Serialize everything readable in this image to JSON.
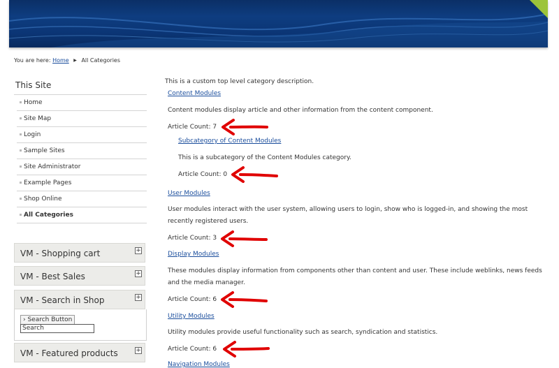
{
  "breadcrumb": {
    "prefix": "You are here:",
    "home": "Home",
    "current": "All Categories"
  },
  "sidebar": {
    "title": "This Site",
    "items": [
      {
        "label": "Home"
      },
      {
        "label": "Site Map"
      },
      {
        "label": "Login"
      },
      {
        "label": "Sample Sites"
      },
      {
        "label": "Site Administrator"
      },
      {
        "label": "Example Pages"
      },
      {
        "label": "Shop Online"
      },
      {
        "label": "All Categories"
      }
    ],
    "modules": [
      {
        "title": "VM - Shopping cart"
      },
      {
        "title": "VM - Best Sales"
      },
      {
        "title": "VM - Search in Shop"
      },
      {
        "title": "VM - Featured products"
      }
    ],
    "search": {
      "button_label": "› Search Button",
      "input_value": "Search"
    }
  },
  "content": {
    "intro": "This is a custom top level category description.",
    "categories": [
      {
        "name": "Content Modules",
        "description": "Content modules display article and other information from the content component.",
        "count": "Article Count: 7",
        "sub": {
          "name": "Subcategory of Content Modules",
          "description": "This is a subcategory of the Content Modules category.",
          "count": "Article Count: 0"
        }
      },
      {
        "name": "User Modules",
        "description": "User modules interact with the user system, allowing users to login, show who is logged-in, and showing the most recently registered users.",
        "count": "Article Count: 3"
      },
      {
        "name": "Display Modules",
        "description": "These modules display information from components other than content and user. These include weblinks, news feeds and the media manager.",
        "count": "Article Count: 6"
      },
      {
        "name": "Utility Modules",
        "description": "Utility modules provide useful functionality such as search, syndication and statistics.",
        "count": "Article Count: 6"
      },
      {
        "name": "Navigation Modules"
      }
    ]
  },
  "colors": {
    "banner": "#0e3d80",
    "link": "#1a4d9c",
    "annotation_arrow": "#e00000",
    "module_header_bg": "#ecece9"
  }
}
